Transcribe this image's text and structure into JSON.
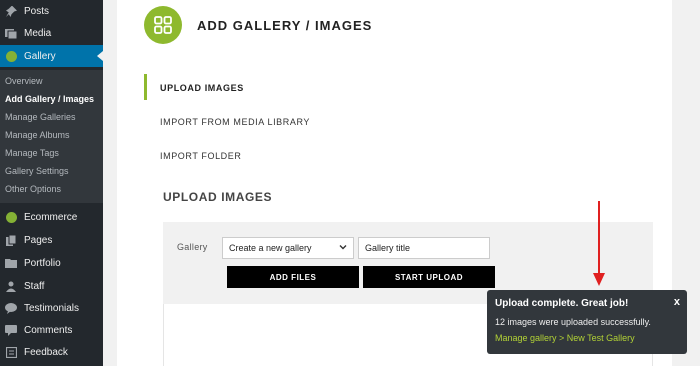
{
  "sidebar": {
    "items": [
      {
        "label": "Posts",
        "icon": "pin-icon"
      },
      {
        "label": "Media",
        "icon": "media-icon"
      },
      {
        "label": "Gallery",
        "icon": "gallery-badge-icon"
      },
      {
        "label": "Ecommerce",
        "icon": "ecommerce-badge-icon"
      },
      {
        "label": "Pages",
        "icon": "pages-icon"
      },
      {
        "label": "Portfolio",
        "icon": "portfolio-icon"
      },
      {
        "label": "Staff",
        "icon": "staff-icon"
      },
      {
        "label": "Testimonials",
        "icon": "testimonials-icon"
      },
      {
        "label": "Comments",
        "icon": "comments-icon"
      },
      {
        "label": "Feedback",
        "icon": "feedback-icon"
      }
    ],
    "gallery_submenu": [
      "Overview",
      "Add Gallery / Images",
      "Manage Galleries",
      "Manage Albums",
      "Manage Tags",
      "Gallery Settings",
      "Other Options"
    ],
    "current_submenu_item": "Add Gallery / Images"
  },
  "header": {
    "title": "ADD GALLERY / IMAGES",
    "logo_icon": "grid-icon",
    "accent_color": "#8eb92e"
  },
  "tabs": [
    {
      "label": "UPLOAD IMAGES",
      "active": true
    },
    {
      "label": "IMPORT FROM MEDIA LIBRARY",
      "active": false
    },
    {
      "label": "IMPORT FOLDER",
      "active": false
    }
  ],
  "upload": {
    "section_title": "UPLOAD IMAGES",
    "gallery_label": "Gallery",
    "gallery_select_value": "Create a new gallery",
    "gallery_title_value": "Gallery title",
    "add_files_label": "ADD FILES",
    "start_upload_label": "START UPLOAD"
  },
  "toast": {
    "title": "Upload complete. Great job!",
    "message": "12 images were uploaded successfully.",
    "link": "Manage gallery > New Test Gallery",
    "close": "x",
    "link_color": "#b2d236"
  },
  "colors": {
    "sidebar_bg": "#23282d",
    "active_menu": "#0073aa",
    "annotation_arrow": "#e02020"
  }
}
